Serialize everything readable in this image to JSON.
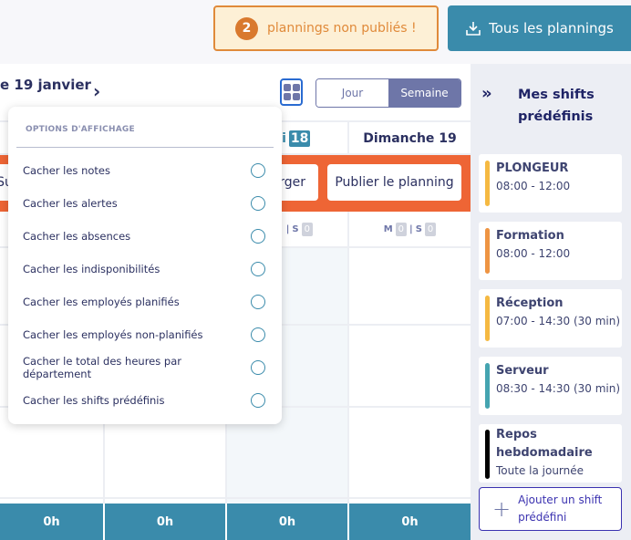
{
  "header": {
    "alert_count": "2",
    "alert_text": "plannings non publiés !",
    "all_plannings_label": "Tous les plannings"
  },
  "toolbar": {
    "date": "e 19 janvier",
    "next_icon": "chevron-right",
    "view_day": "Jour",
    "view_week": "Semaine"
  },
  "days": [
    {
      "label": "edi",
      "badge": "18"
    },
    {
      "label": "Dimanche 19"
    }
  ],
  "actions": {
    "left_partial": "Su",
    "middle_partial": "rger",
    "publish": "Publier le planning"
  },
  "counts": {
    "m": "M",
    "s": "S",
    "m_val": "0",
    "s_val": "0"
  },
  "footer_totals": [
    "0h",
    "0h",
    "0h",
    "0h"
  ],
  "dropdown": {
    "title": "OPTIONS D'AFFICHAGE",
    "options": [
      "Cacher les notes",
      "Cacher les alertes",
      "Cacher les absences",
      "Cacher les indisponibilités",
      "Cacher les employés planifiés",
      "Cacher les employés non-planifiés",
      "Cacher le total des heures par département",
      "Cacher les shifts prédéfinis"
    ]
  },
  "sidebar": {
    "title": "Mes shifts prédéfinis",
    "shifts": [
      {
        "name": "PLONGEUR",
        "time": "08:00 - 12:00",
        "color": "#f5b942"
      },
      {
        "name": "Formation",
        "time": "08:00 - 12:00",
        "color": "#ee9443"
      },
      {
        "name": "Réception",
        "time": "07:00 - 14:30 (30 min)",
        "color": "#f5b942"
      },
      {
        "name": "Serveur",
        "time": "08:30 - 14:30 (30 min)",
        "color": "#45a4b0"
      },
      {
        "name": "Repos hebdomadaire",
        "time": "Toute la journée",
        "color": "#000000"
      }
    ],
    "add_label": "Ajouter un shift prédéfini"
  },
  "colors": {
    "accent": "#3a8bab",
    "orange": "#ee6535",
    "alert": "#e08a3a"
  }
}
